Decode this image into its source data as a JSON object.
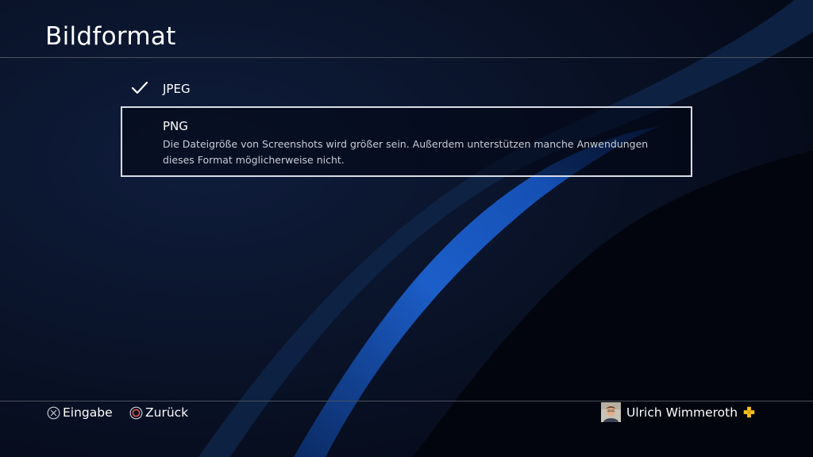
{
  "page": {
    "title": "Bildformat"
  },
  "options": [
    {
      "label": "JPEG",
      "selected": true,
      "icon": "checkmark-icon"
    },
    {
      "label": "PNG",
      "focused": true,
      "description": "Die Dateigröße von Screenshots wird größer sein. Außerdem unterstützen manche Anwendungen dieses Format möglicherweise nicht."
    }
  ],
  "footer": {
    "enter_label": "Eingabe",
    "enter_icon": "cross-button-icon",
    "back_label": "Zurück",
    "back_icon": "circle-button-icon"
  },
  "user": {
    "name": "Ulrich Wimmeroth",
    "avatar_icon": "user-avatar",
    "plus_icon": "playstation-plus-icon"
  },
  "colors": {
    "background": "#050a18",
    "wave_accent": "#1c5ec9",
    "focus_border": "#d8dde6",
    "text": "#ffffff",
    "secondary_text": "#c9cdd6",
    "plus_badge": "#f3c21a",
    "circle_button": "#e85a4a"
  }
}
